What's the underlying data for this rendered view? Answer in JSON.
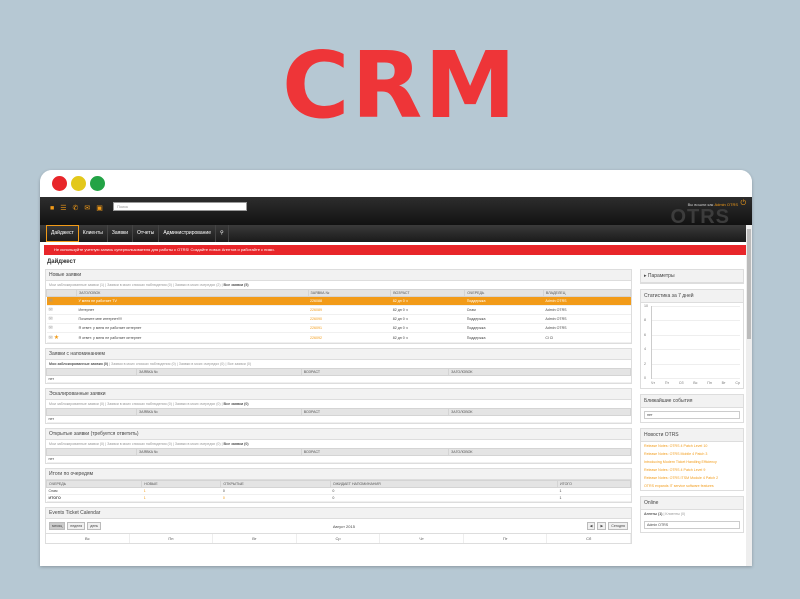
{
  "hero": {
    "title": "CRM"
  },
  "window": {
    "search_placeholder": "Поиск",
    "logout_prefix": "Вы вошли как",
    "logout_user": "Admin OTRS",
    "logo": "OTRS"
  },
  "toolbar_icons": [
    "folder-icon",
    "list-icon",
    "phone-icon",
    "email-icon",
    "lock-icon"
  ],
  "nav": [
    "Дайджест",
    "Клиенты",
    "Заявки",
    "Отчеты",
    "Администрирование"
  ],
  "alert": "Не используйте учетную запись суперпользователя для работы с OTRS! Создайте новых Агентов и работайте с ними.",
  "page_title": "Дайджест",
  "new_tickets": {
    "title": "Новые заявки",
    "filters": [
      "Мои заблокированные заявки (1)",
      "Заявки в моих списках наблюдения (0)",
      "Заявки в моих очередях (2)"
    ],
    "filter_all": "Все заявки (5)",
    "columns": [
      "ЗАГОЛОВОК",
      "ЗАЯВКА №",
      "ВОЗРАСТ",
      "ОЧЕРЕДЬ",
      "ВЛАДЕЛЕЦ"
    ],
    "rows": [
      [
        "У меня не работает ТV",
        "226088",
        "82 дн 0 ч",
        "Поддержка",
        "Admin OTRS"
      ],
      [
        "Интернет",
        "226089",
        "82 дн 0 ч",
        "Спам",
        "Admin OTRS"
      ],
      [
        "Почините мне интернет!!!!",
        "226090",
        "82 дн 0 ч",
        "Поддержка",
        "Admin OTRS"
      ],
      [
        "Я ответ: у меня не работает интернет",
        "226091",
        "82 дн 0 ч",
        "Поддержка",
        "Admin OTRS"
      ],
      [
        "Я ответ: у меня не работает интернет",
        "226092",
        "82 дн 0 ч",
        "Поддержка",
        "Cl Cl"
      ]
    ]
  },
  "reminder_tickets": {
    "title": "Заявки с напоминанием",
    "filters": [
      "Мои заблокированные заявки (0)",
      "Заявки в моих списках наблюдения (0)",
      "Заявки в моих очередях (0)"
    ],
    "filter_all": "Все заявки (0)",
    "columns": [
      "ЗАЯВКА №",
      "ВОЗРАСТ",
      "ЗАГОЛОВОК"
    ],
    "empty": "нет"
  },
  "escalated_tickets": {
    "title": "Эскалированные заявки",
    "filters": [
      "Мои заблокированные заявки (0)",
      "Заявки в моих списках наблюдения (0)",
      "Заявки в моих очередях (0)"
    ],
    "filter_all": "Все заявки (0)",
    "columns": [
      "ЗАЯВКА №",
      "ВОЗРАСТ",
      "ЗАГОЛОВОК"
    ],
    "empty": "нет"
  },
  "open_tickets": {
    "title": "Открытые заявки (требуется ответить)",
    "filters": [
      "Мои заблокированные заявки (0)",
      "Заявки в моих списках наблюдения (0)",
      "Заявки в моих очередях (0)"
    ],
    "filter_all": "Все заявки (0)",
    "columns": [
      "ЗАЯВКА №",
      "ВОЗРАСТ",
      "ЗАГОЛОВОК"
    ],
    "empty": "нет"
  },
  "queue_totals": {
    "title": "Итоги по очередям",
    "columns": [
      "ОЧЕРЕДЬ",
      "НОВЫЕ",
      "ОТКРЫТЫЕ",
      "ОЖИДАЕТ НАПОМИНАНИЯ",
      "ИТОГО"
    ],
    "rows": [
      [
        "Спам",
        "1",
        "0",
        "0",
        "1"
      ],
      [
        "ИТОГО",
        "1",
        "0",
        "0",
        "1"
      ]
    ]
  },
  "calendar": {
    "title": "Events Ticket Calendar",
    "views": [
      "месяц",
      "неделя",
      "день"
    ],
    "month": "Август 2015",
    "today": "Сегодня",
    "prev": "◀",
    "next": "▶",
    "days": [
      "Вс",
      "Пн",
      "Вт",
      "Ср",
      "Чт",
      "Пт",
      "Сб"
    ]
  },
  "sidebar": {
    "params_label": "Параметры",
    "stats_title": "Статистика за 7 дней",
    "chart_data": {
      "type": "line",
      "title": "Статистика за 7 дней",
      "categories": [
        "Чт",
        "Пт",
        "Сб",
        "Вс",
        "Пн",
        "Вт",
        "Ср"
      ],
      "yticks": [
        "10",
        "8",
        "6",
        "4",
        "2",
        "0"
      ],
      "ylim": [
        0,
        10
      ]
    },
    "events_title": "Ближайшие события",
    "events_empty": "нет",
    "news_title": "Новости OTRS",
    "news": [
      "Release Notes: OTRS 4 Patch Level 10",
      "Release Notes: OTRS Mobile 4 Patch 3",
      "Introducing Modern Ticket Handling Efficiency",
      "Release Notes: OTRS 4 Patch Level 9",
      "Release Notes: OTRS ITSM Module 4 Patch 2",
      "OTRS expands IT service software features"
    ],
    "online_title": "Online",
    "online_tabs_active": "Агенты (1)",
    "online_tabs_other": "Клиенты (0)",
    "online_user": "Admin OTRS"
  }
}
